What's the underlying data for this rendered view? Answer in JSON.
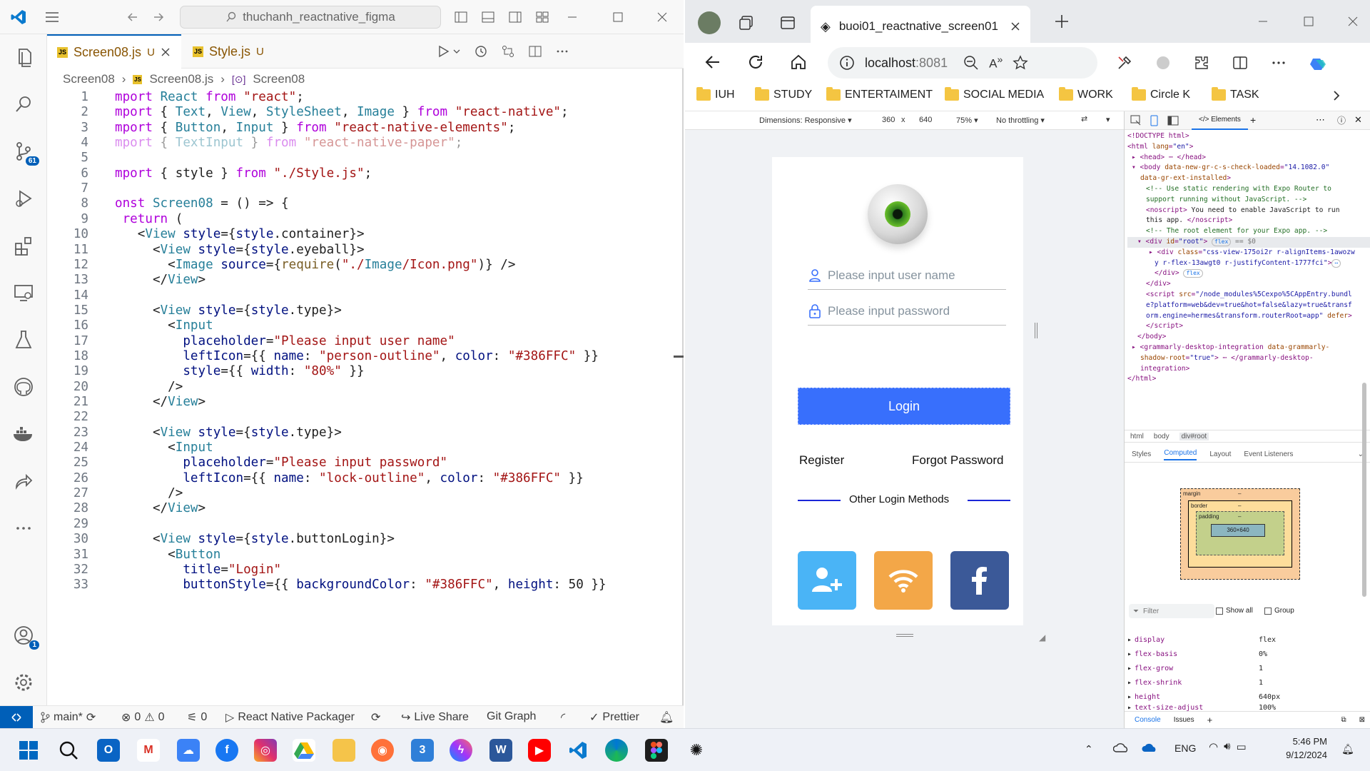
{
  "vscode": {
    "search": "thuchanh_reactnative_figma",
    "tabs": [
      {
        "name": "Screen08.js",
        "status": "U"
      },
      {
        "name": "Style.js",
        "status": "U"
      }
    ],
    "breadcrumb": [
      "Screen08",
      "Screen08.js",
      "Screen08"
    ],
    "badges": {
      "source_control": "61",
      "accounts": "1"
    },
    "code_lines": [
      "mport React from \"react\";",
      "mport { Text, View, StyleSheet, Image } from \"react-native\";",
      "mport { Button, Input } from \"react-native-elements\";",
      "mport { TextInput } from \"react-native-paper\";",
      "",
      "mport { style } from \"./Style.js\";",
      "",
      "onst Screen08 = () => {",
      " return (",
      "   <View style={style.container}>",
      "     <View style={style.eyeball}>",
      "       <Image source={require(\"./Image/Icon.png\")} />",
      "     </View>",
      "",
      "     <View style={style.type}>",
      "       <Input",
      "         placeholder=\"Please input user name\"",
      "         leftIcon={{ name: \"person-outline\", color: \"#386FFC\" }}",
      "         style={{ width: \"80%\" }}",
      "       />",
      "     </View>",
      "",
      "     <View style={style.type}>",
      "       <Input",
      "         placeholder=\"Please input password\"",
      "         leftIcon={{ name: \"lock-outline\", color: \"#386FFC\" }}",
      "       />",
      "     </View>",
      "",
      "     <View style={style.buttonLogin}>",
      "       <Button",
      "         title=\"Login\"",
      "         buttonStyle={{ backgroundColor: \"#386FFC\", height: 50 }}"
    ],
    "line_numbers": [
      "1",
      "2",
      "3",
      "4",
      "5",
      "6",
      "7",
      "8",
      "9",
      "10",
      "11",
      "12",
      "13",
      "14",
      "15",
      "16",
      "17",
      "18",
      "19",
      "20",
      "21",
      "22",
      "23",
      "24",
      "25",
      "26",
      "27",
      "28",
      "29",
      "30",
      "31",
      "32",
      "33"
    ],
    "status": {
      "branch": "main*",
      "errors": "0",
      "warnings": "0",
      "ports": "0",
      "packager": "React Native Packager",
      "live_share": "Live Share",
      "git_graph": "Git Graph",
      "prettier": "Prettier"
    }
  },
  "edge": {
    "tab_title": "buoi01_reactnative_screen01",
    "url_host": "localhost",
    "url_port": ":8081",
    "favorites": [
      "IUH",
      "STUDY",
      "ENTERTAIMENT",
      "SOCIAL MEDIA",
      "WORK",
      "Circle K",
      "TASK"
    ],
    "device_toolbar": {
      "dimensions": "Dimensions: Responsive",
      "width": "360",
      "times": "x",
      "height": "640",
      "zoom": "75%",
      "throttling": "No throttling"
    },
    "app": {
      "username_placeholder": "Please input user name",
      "password_placeholder": "Please input password",
      "login": "Login",
      "register": "Register",
      "forgot": "Forgot Password",
      "other_methods": "Other Login Methods",
      "accent": "#386FFC"
    },
    "devtools": {
      "elements_tab": "Elements",
      "crumbs": [
        "html",
        "body",
        "div#root"
      ],
      "subtabs": [
        "Styles",
        "Computed",
        "Layout",
        "Event Listeners"
      ],
      "box": {
        "margin": "margin",
        "border": "border",
        "padding": "padding",
        "content": "360×640",
        "dash": "–"
      },
      "filter_placeholder": "Filter",
      "show_all": "Show all",
      "group": "Group",
      "properties": [
        {
          "name": "display",
          "value": "flex"
        },
        {
          "name": "flex-basis",
          "value": "0%"
        },
        {
          "name": "flex-grow",
          "value": "1"
        },
        {
          "name": "flex-shrink",
          "value": "1"
        },
        {
          "name": "height",
          "value": "640px"
        },
        {
          "name": "text-size-adjust",
          "value": "100%"
        }
      ],
      "bottom_tabs": [
        "Console",
        "Issues"
      ]
    }
  },
  "taskbar": {
    "language": "ENG",
    "time": "5:46 PM",
    "date": "9/12/2024"
  }
}
